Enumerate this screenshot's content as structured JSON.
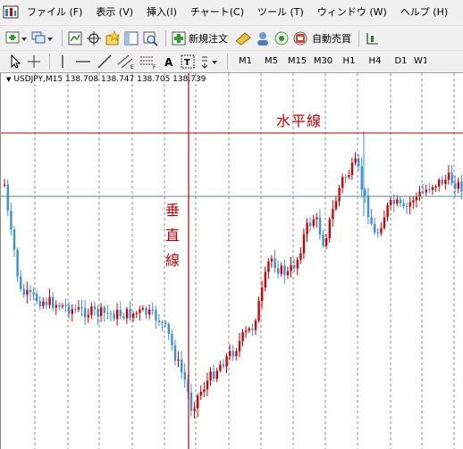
{
  "menu": [
    "ファイル (F)",
    "表示 (V)",
    "挿入(I)",
    "チャート(C)",
    "ツール (T)",
    "ウィンドウ (W)",
    "ヘルプ (H)"
  ],
  "toolbar": {
    "new_order": "新規注文",
    "auto_trade": "自動売買"
  },
  "timeframes": [
    "M1",
    "M5",
    "M15",
    "M30",
    "H1",
    "H4",
    "D1",
    "W1"
  ],
  "chart": {
    "symbol_line": "USDJPY,M15  138.708 138.747 138.705 138.739",
    "horizontal_label": "水平線",
    "vertical_label": [
      "垂",
      "直",
      "線"
    ]
  },
  "colors": {
    "bull": "#d40000",
    "bear": "#3a8fe0",
    "line": "#c80000",
    "grid": "#6e6e6e",
    "hline2": "#5a8a8a"
  },
  "icons": [
    "app-icon",
    "new-chart-icon",
    "profiles-icon",
    "indicators-icon",
    "crosshair-icon",
    "favorites-icon",
    "navigator-icon",
    "zoom-icon",
    "new-order-icon",
    "metaeditor-icon",
    "user-icon",
    "signal-icon",
    "autotrade-icon",
    "period-icon",
    "cursor-icon",
    "crosshair-tool-icon",
    "vertical-line-icon",
    "horizontal-line-icon",
    "trendline-icon",
    "channel-icon",
    "fibo-icon",
    "text-icon",
    "label-icon",
    "arrow-tool-icon"
  ]
}
